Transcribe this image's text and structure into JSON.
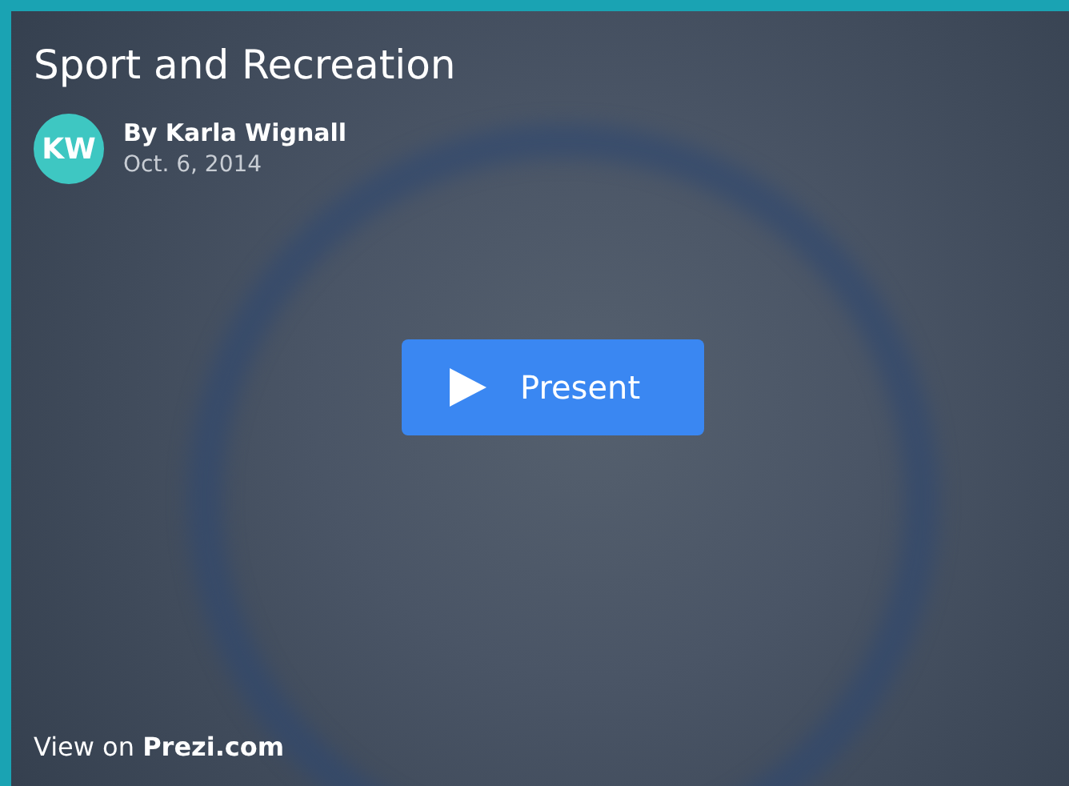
{
  "title": "Sport and Recreation",
  "author": {
    "initials": "KW",
    "byline": "By Karla Wignall",
    "date": "Oct. 6, 2014"
  },
  "present_button": {
    "label": "Present"
  },
  "footer_link": "View on **Prezi.com**"
}
